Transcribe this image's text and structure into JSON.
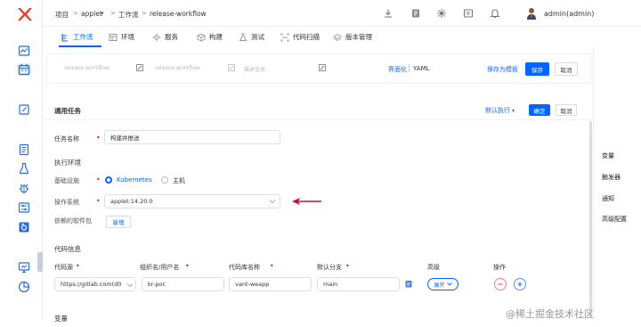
{
  "breadcrumb": {
    "items": [
      "项目",
      "applet",
      "工作流",
      "release-workflow"
    ],
    "separator": ">",
    "dropdown_glyph": "▾"
  },
  "header": {
    "username": "admin(admin)"
  },
  "tabs": [
    {
      "label": "工作流",
      "icon": "workflow-icon",
      "active": true
    },
    {
      "label": "环境",
      "icon": "environment-icon"
    },
    {
      "label": "服务",
      "icon": "service-icon"
    },
    {
      "label": "构建",
      "icon": "build-icon"
    },
    {
      "label": "测试",
      "icon": "test-icon"
    },
    {
      "label": "代码扫描",
      "icon": "code-scan-icon"
    },
    {
      "label": "版本管理",
      "icon": "version-icon"
    }
  ],
  "workflow_bar": {
    "name_value": "release-workflow",
    "display_name_value": "release-workflow",
    "description_placeholder": "描述信息",
    "view_gui": "界面化",
    "view_yaml": "YAML",
    "save_as_template": "保存为模板",
    "save": "保存",
    "cancel": "取消"
  },
  "task_panel": {
    "title": "通用任务",
    "default_exec": "默认执行",
    "confirm": "确定",
    "cancel": "取消"
  },
  "form": {
    "task_name_label": "任务名称",
    "task_name_value": "构建并推送",
    "exec_env_title": "执行环境",
    "infra_label": "基础设施",
    "infra_options": [
      "Kubernetes",
      "主机"
    ],
    "os_label": "操作系统",
    "os_value": "applet:14.20.0",
    "deps_label": "依赖的软件包",
    "deps_button": "新增",
    "code_info_title": "代码信息",
    "repo_headers": [
      "代码源",
      "组织名/用户名",
      "代码库名称",
      "默认分支",
      "高级",
      "操作"
    ],
    "repo_row": {
      "source": "https://gitlab.com(d0",
      "org": "kr-poc",
      "repo": "vant-weapp",
      "branch": "main",
      "advanced": "展开"
    },
    "vars_title": "变量"
  },
  "right_panel": [
    "变量",
    "触发器",
    "通知",
    "高级配置"
  ],
  "watermark": "@稀土掘金技术社区",
  "colors": {
    "accent": "#0066ff",
    "danger": "#e02020",
    "arrow": "#c8102e"
  }
}
